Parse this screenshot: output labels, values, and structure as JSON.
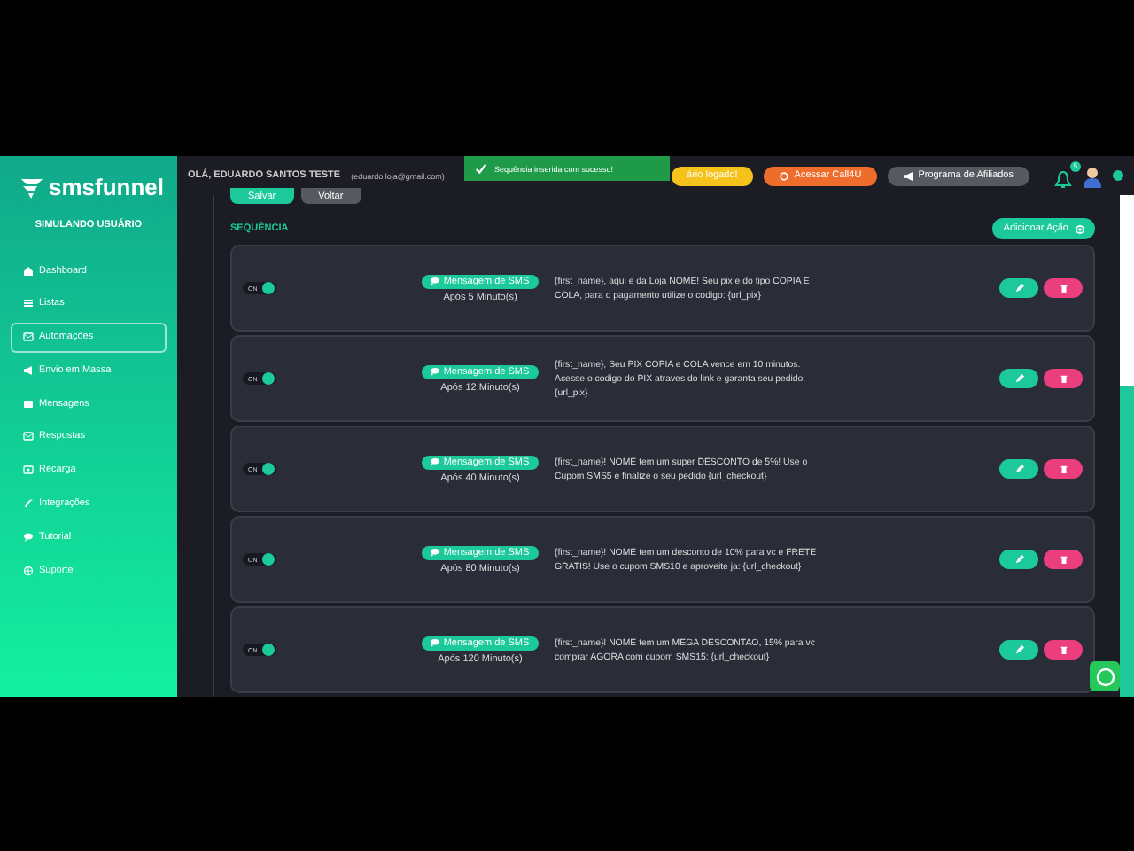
{
  "sidebar": {
    "logo": "smsfunnel",
    "subtitle": "SIMULANDO USUÁRIO",
    "items": [
      {
        "label": "Dashboard",
        "selected": false
      },
      {
        "label": "Listas",
        "selected": false
      },
      {
        "label": "Automações",
        "selected": true
      },
      {
        "label": "Envio em Massa",
        "selected": false
      },
      {
        "label": "Mensagens",
        "selected": false
      },
      {
        "label": "Respostas",
        "selected": false
      },
      {
        "label": "Recarga",
        "selected": false
      },
      {
        "label": "Integrações",
        "selected": false
      },
      {
        "label": "Tutorial",
        "selected": false
      },
      {
        "label": "Suporte",
        "selected": false
      }
    ]
  },
  "header": {
    "greeting": "OLÁ, EDUARDO SANTOS TESTE",
    "email": "(eduardo.loja@gmail.com)",
    "buttons": [
      {
        "label": "ário logado!",
        "kind": "yellow"
      },
      {
        "label": "Acessar Call4U",
        "kind": "orange"
      },
      {
        "label": "Programa de Afiliados",
        "kind": "gray"
      }
    ],
    "notification_count": "5"
  },
  "toast": {
    "message": "Sequência inserida com sucesso!"
  },
  "form_buttons": [
    "Salvar",
    "Voltar"
  ],
  "section_title": "SEQUÊNCIA",
  "add_button": "Adicionar Ação",
  "rows": [
    {
      "on": true,
      "toggle_label": "ON",
      "type": "Mensagem de SMS",
      "delay": "Após 5 Minuto(s)",
      "message": "{first_name}, aqui e da Loja NOME! Seu pix e do tipo COPIA E COLA, para o pagamento utilize o codigo: {url_pix}"
    },
    {
      "on": true,
      "toggle_label": "ON",
      "type": "Mensagem de SMS",
      "delay": "Após 12 Minuto(s)",
      "message": "{first_name}, Seu PIX COPIA e COLA vence em 10 minutos. Acesse o codigo do PIX atraves do link e garanta seu pedido: {url_pix}"
    },
    {
      "on": true,
      "toggle_label": "ON",
      "type": "Mensagem de SMS",
      "delay": "Após 40 Minuto(s)",
      "message": "{first_name}! NOME tem um super DESCONTO de 5%! Use o Cupom SMS5 e finalize o seu pedido {url_checkout}"
    },
    {
      "on": true,
      "toggle_label": "ON",
      "type": "Mensagem de SMS",
      "delay": "Após 80 Minuto(s)",
      "message": "{first_name}! NOME tem um desconto de 10% para vc e FRETE GRATIS! Use o cupom SMS10 e aproveite ja: {url_checkout}"
    },
    {
      "on": true,
      "toggle_label": "ON",
      "type": "Mensagem de SMS",
      "delay": "Após 120 Minuto(s)",
      "message": "{first_name}! NOME tem um MEGA DESCONTAO, 15% para vc comprar AGORA com cupom SMS15: {url_checkout}"
    }
  ]
}
